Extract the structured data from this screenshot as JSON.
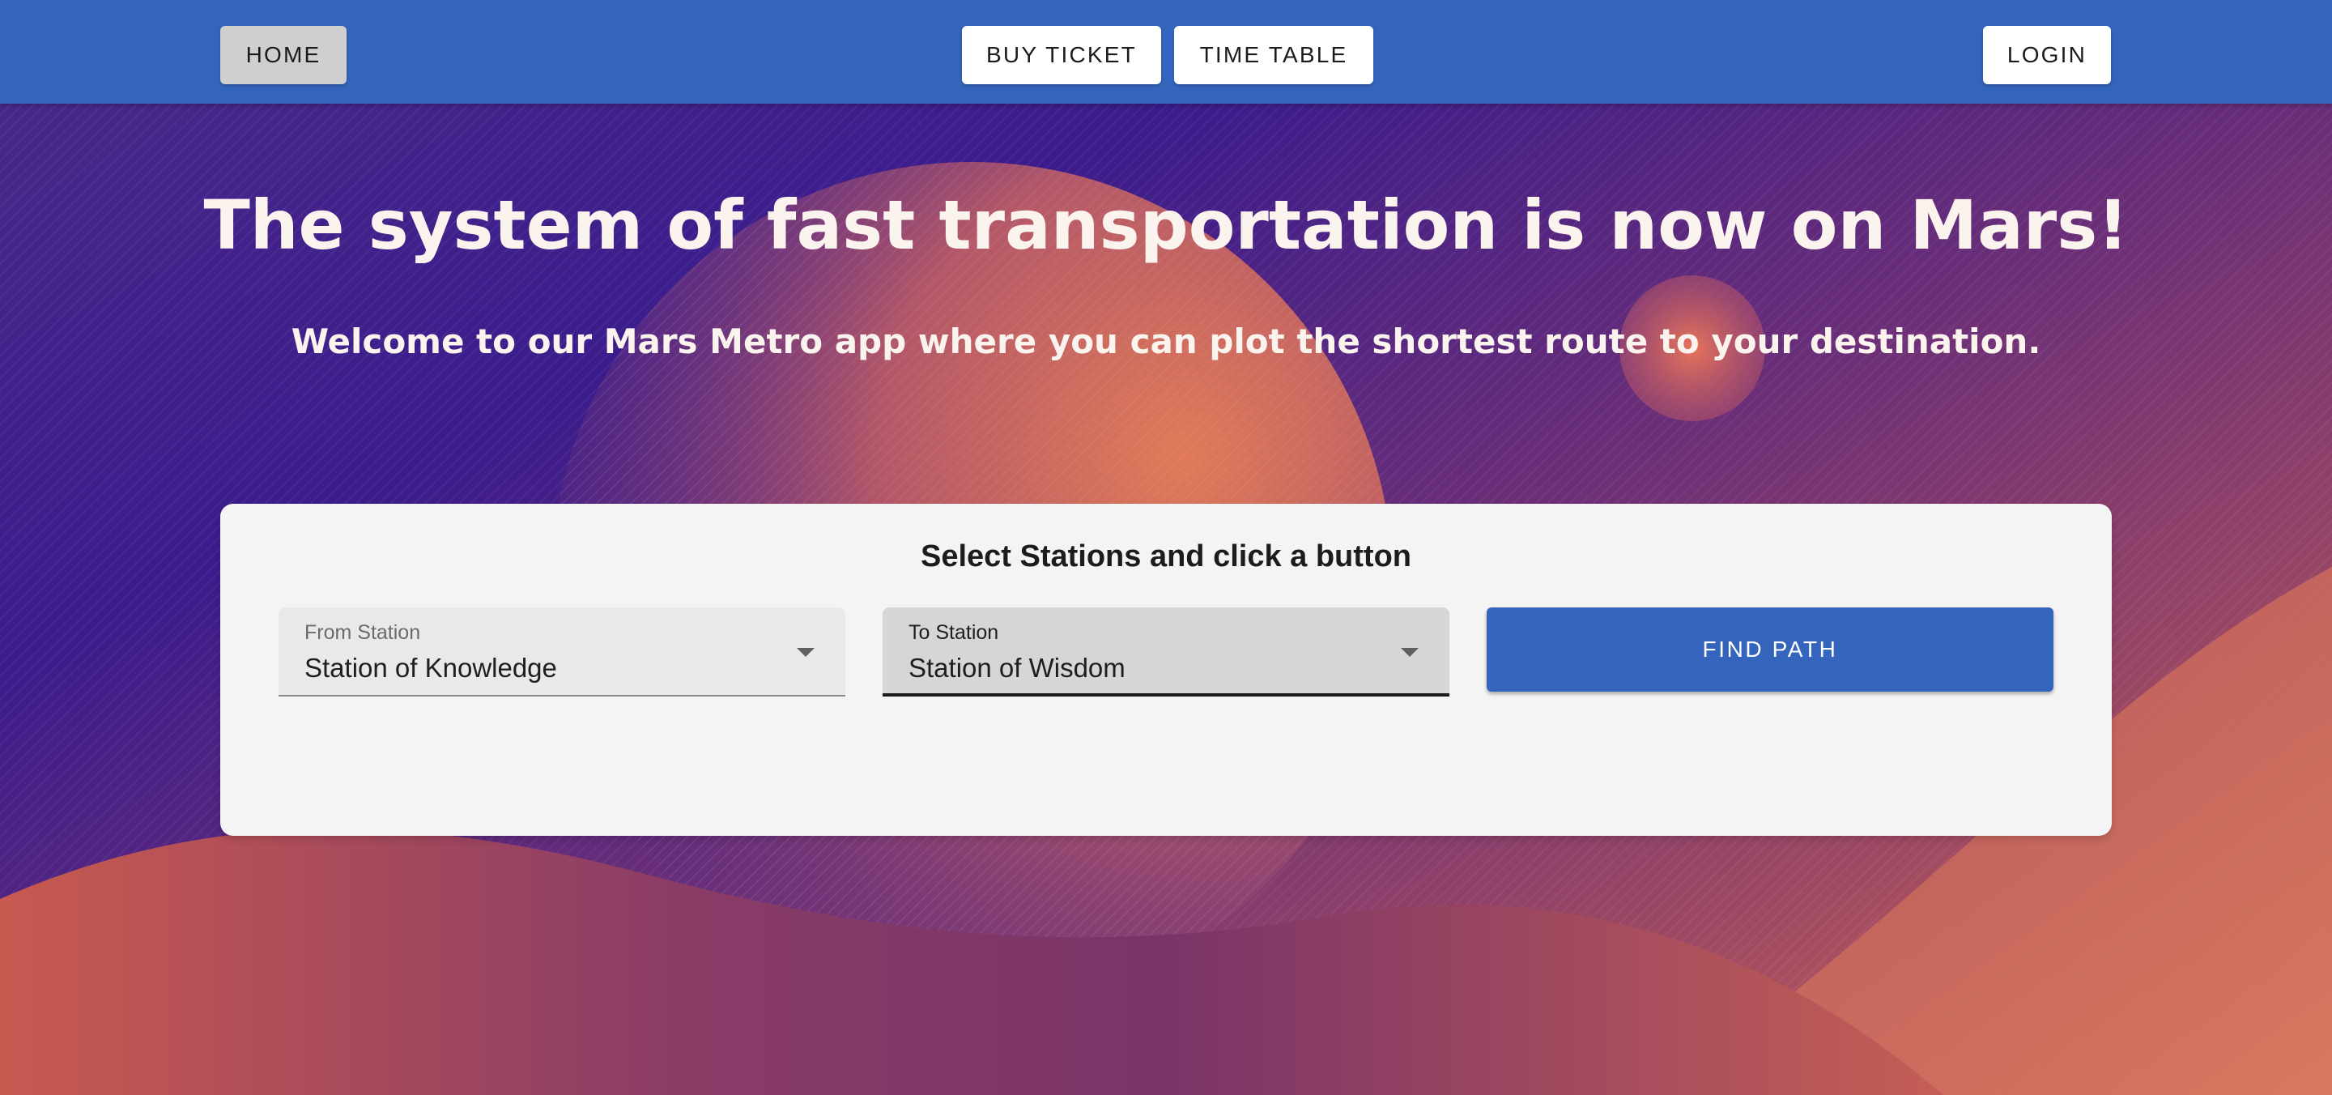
{
  "nav": {
    "home": "HOME",
    "buy_ticket": "BUY TICKET",
    "time_table": "TIME TABLE",
    "login": "LOGIN"
  },
  "hero": {
    "title": "The system of fast transportation is now on Mars!",
    "subtitle": "Welcome to our Mars Metro app where you can plot the shortest route to your destination."
  },
  "card": {
    "title": "Select Stations and click a button",
    "from": {
      "label": "From Station",
      "value": "Station of Knowledge"
    },
    "to": {
      "label": "To Station",
      "value": "Station of Wisdom"
    },
    "find_button": "FIND PATH"
  },
  "colors": {
    "nav_blue": "#3464bb",
    "card_bg": "#f4f4f4",
    "bg_purple": "#3a1a8a",
    "bg_orange": "#d06850"
  }
}
